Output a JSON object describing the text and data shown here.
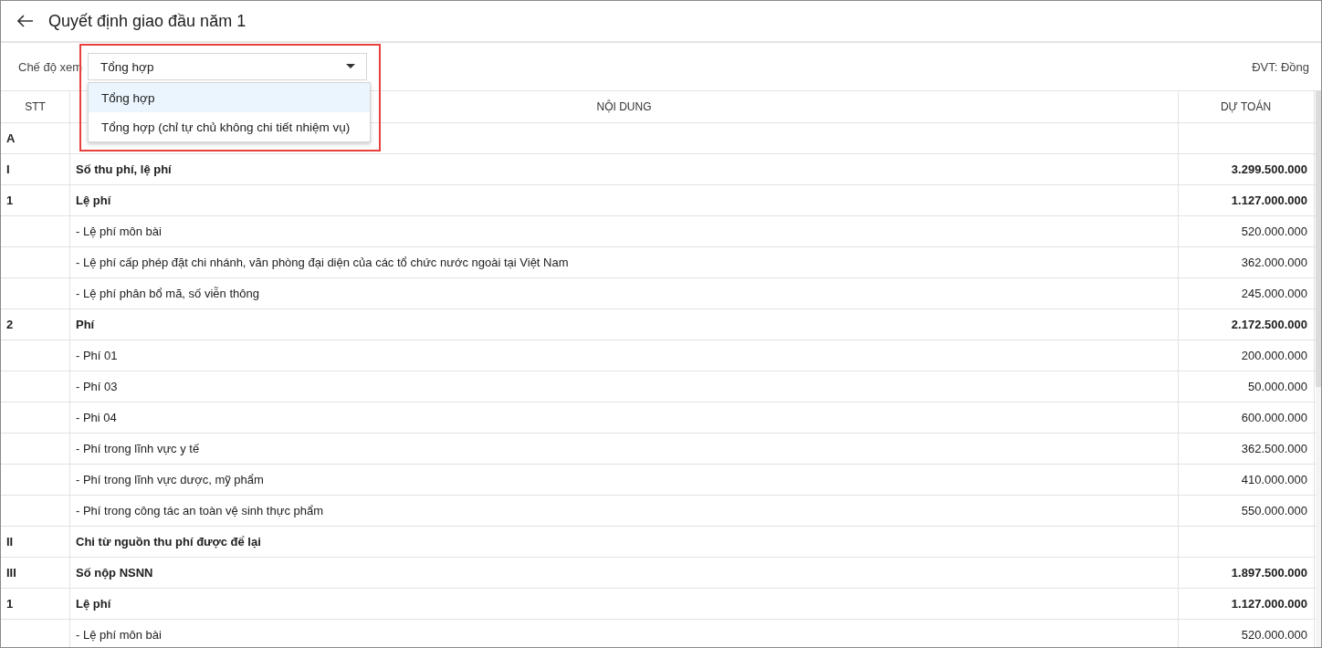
{
  "header": {
    "title": "Quyết định giao đầu năm 1"
  },
  "toolbar": {
    "view_mode_label": "Chế độ xem",
    "view_mode_value": "Tổng hợp",
    "unit": "ĐVT: Đồng"
  },
  "dropdown": {
    "highlighted": true,
    "options": [
      {
        "label": "Tổng hợp",
        "selected": true
      },
      {
        "label": "Tổng hợp (chỉ tự chủ không chi tiết nhiệm vụ)",
        "selected": false
      }
    ]
  },
  "table": {
    "columns": [
      "STT",
      "NỘI DUNG",
      "DỰ TOÁN"
    ],
    "rows": [
      {
        "kind": "group",
        "stt": "A",
        "content": "",
        "amount": ""
      },
      {
        "kind": "group",
        "stt": "I",
        "content": "Số thu phí, lệ phí",
        "amount": "3.299.500.000"
      },
      {
        "kind": "group",
        "stt": "1",
        "content": "Lệ phí",
        "amount": "1.127.000.000"
      },
      {
        "kind": "item",
        "stt": "",
        "content": "- Lệ phí môn bài",
        "amount": "520.000.000"
      },
      {
        "kind": "item",
        "stt": "",
        "content": "- Lệ phí cấp phép đặt chi nhánh, văn phòng đại diện của các tổ chức nước ngoài tại Việt Nam",
        "amount": "362.000.000"
      },
      {
        "kind": "item",
        "stt": "",
        "content": "- Lệ phí phân bổ mã, số viễn thông",
        "amount": "245.000.000"
      },
      {
        "kind": "group",
        "stt": "2",
        "content": "Phí",
        "amount": "2.172.500.000"
      },
      {
        "kind": "item",
        "stt": "",
        "content": "- Phí 01",
        "amount": "200.000.000"
      },
      {
        "kind": "item",
        "stt": "",
        "content": "- Phí 03",
        "amount": "50.000.000"
      },
      {
        "kind": "item",
        "stt": "",
        "content": "- Phi 04",
        "amount": "600.000.000"
      },
      {
        "kind": "item",
        "stt": "",
        "content": "- Phí trong lĩnh vực y tế",
        "amount": "362.500.000"
      },
      {
        "kind": "item",
        "stt": "",
        "content": "- Phí trong lĩnh vực dược, mỹ phẩm",
        "amount": "410.000.000"
      },
      {
        "kind": "item",
        "stt": "",
        "content": "- Phí trong công tác an toàn vệ sinh thực phẩm",
        "amount": "550.000.000"
      },
      {
        "kind": "group",
        "stt": "II",
        "content": "Chi từ nguồn thu phí được để lại",
        "amount": ""
      },
      {
        "kind": "group",
        "stt": "III",
        "content": "Số nộp NSNN",
        "amount": "1.897.500.000"
      },
      {
        "kind": "group",
        "stt": "1",
        "content": "Lệ phí",
        "amount": "1.127.000.000"
      },
      {
        "kind": "item",
        "stt": "",
        "content": "- Lệ phí môn bài",
        "amount": "520.000.000"
      }
    ]
  }
}
